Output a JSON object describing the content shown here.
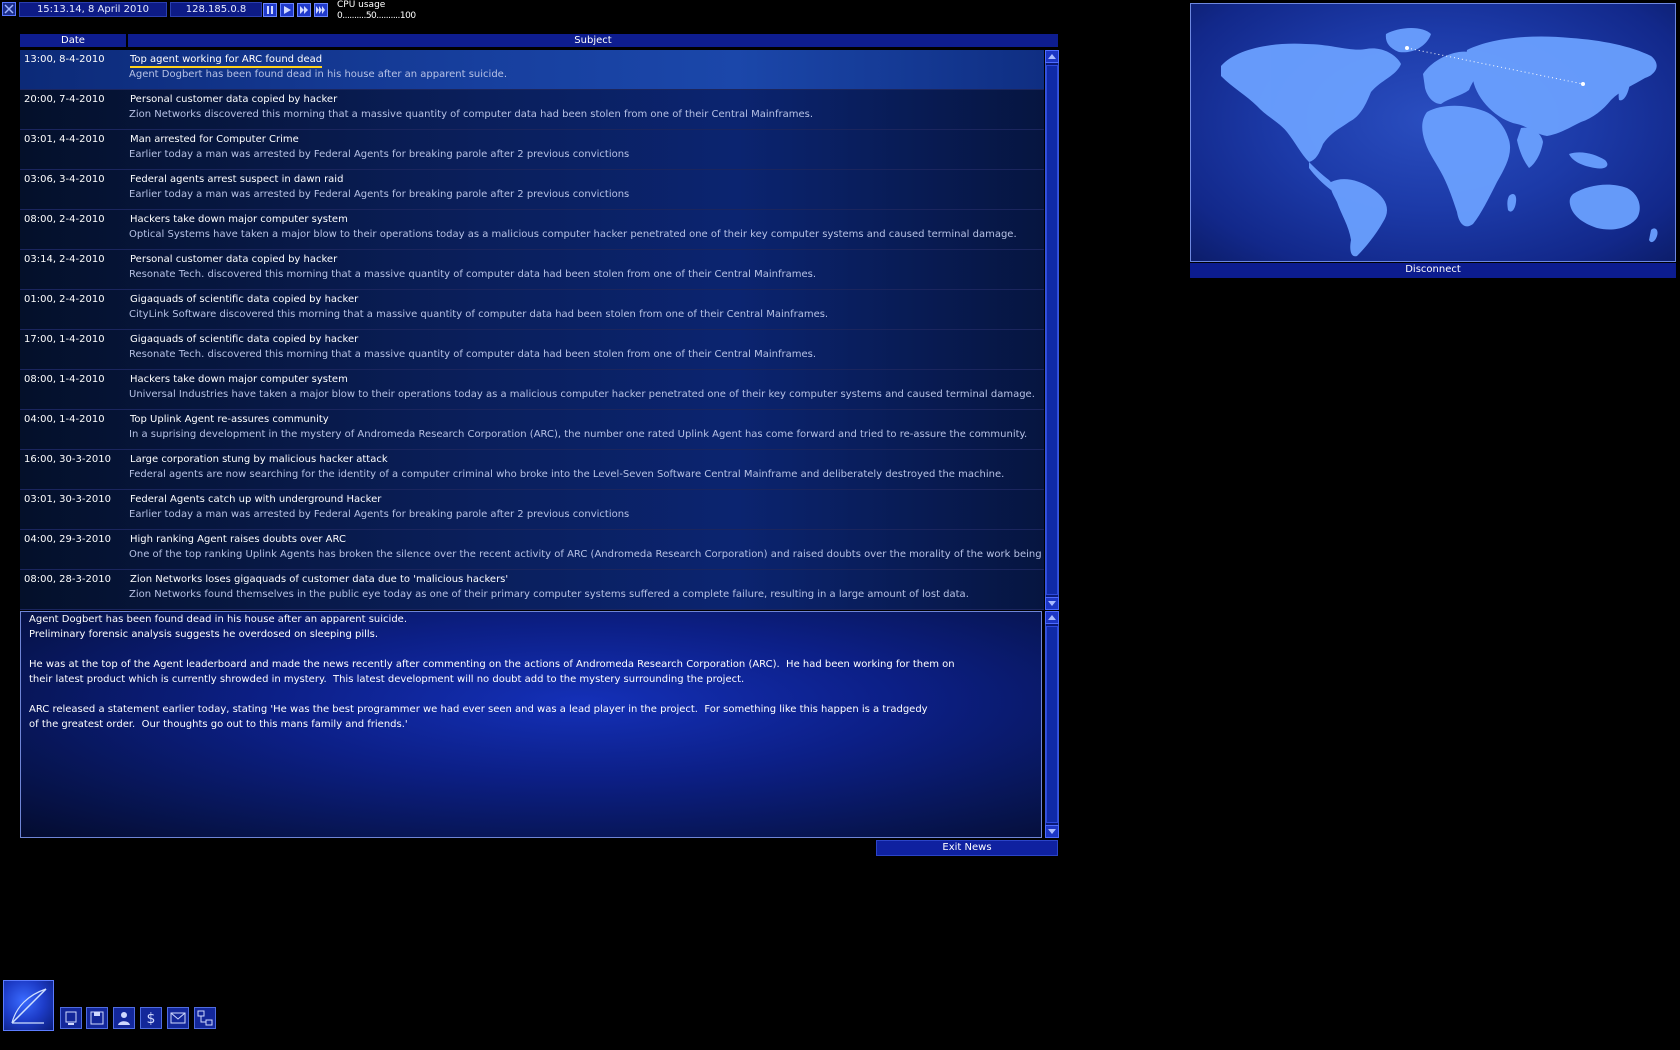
{
  "topbar": {
    "datetime": "15:13.14, 8 April 2010",
    "ip": "128.185.0.8",
    "cpu_label": "CPU usage",
    "cpu_scale": "0..........50..........100",
    "speed_buttons": [
      "pause-icon",
      "play-icon",
      "fast-forward-icon",
      "fastest-icon"
    ]
  },
  "news": {
    "col_date": "Date",
    "col_subject": "Subject",
    "items": [
      {
        "date": "13:00, 8-4-2010",
        "title": "Top agent working for ARC found dead",
        "summary": "Agent Dogbert has been found dead in his house after an apparent suicide.",
        "selected": true
      },
      {
        "date": "20:00, 7-4-2010",
        "title": "Personal customer data copied by hacker",
        "summary": "Zion Networks discovered this morning that a massive quantity of computer data had been stolen from one of their Central Mainframes."
      },
      {
        "date": "03:01, 4-4-2010",
        "title": "Man arrested for Computer Crime",
        "summary": "Earlier today a man was arrested by Federal Agents for breaking parole after 2 previous convictions"
      },
      {
        "date": "03:06, 3-4-2010",
        "title": "Federal agents arrest suspect in dawn raid",
        "summary": "Earlier today a man was arrested by Federal Agents for breaking parole after 2 previous convictions"
      },
      {
        "date": "08:00, 2-4-2010",
        "title": "Hackers take down major computer system",
        "summary": "Optical Systems have taken a major blow to their operations today as a malicious computer hacker penetrated one of their key computer systems and caused terminal damage."
      },
      {
        "date": "03:14, 2-4-2010",
        "title": "Personal customer data copied by hacker",
        "summary": "Resonate Tech. discovered this morning that a massive quantity of computer data had been stolen from one of their Central Mainframes."
      },
      {
        "date": "01:00, 2-4-2010",
        "title": "Gigaquads of scientific data copied by hacker",
        "summary": "CityLink Software discovered this morning that a massive quantity of computer data had been stolen from one of their Central Mainframes."
      },
      {
        "date": "17:00, 1-4-2010",
        "title": "Gigaquads of scientific data copied by hacker",
        "summary": "Resonate Tech. discovered this morning that a massive quantity of computer data had been stolen from one of their Central Mainframes."
      },
      {
        "date": "08:00, 1-4-2010",
        "title": "Hackers take down major computer system",
        "summary": "Universal Industries have taken a major blow to their operations today as a malicious computer hacker penetrated one of their key computer systems and caused terminal damage."
      },
      {
        "date": "04:00, 1-4-2010",
        "title": "Top Uplink Agent re-assures community",
        "summary": "In a suprising development in the mystery of Andromeda Research Corporation (ARC), the number one rated Uplink Agent has come forward and tried to re-assure the community."
      },
      {
        "date": "16:00, 30-3-2010",
        "title": "Large corporation stung by malicious hacker attack",
        "summary": "Federal agents are now searching for the identity of a computer criminal who broke into the Level-Seven Software Central Mainframe and deliberately destroyed the machine."
      },
      {
        "date": "03:01, 30-3-2010",
        "title": "Federal Agents catch up with underground Hacker",
        "summary": "Earlier today a man was arrested by Federal Agents for breaking parole after 2 previous convictions"
      },
      {
        "date": "04:00, 29-3-2010",
        "title": "High ranking Agent raises doubts over ARC",
        "summary": "One of the top ranking Uplink Agents has broken the silence over the recent activity of ARC (Andromeda Research Corporation) and raised doubts over the morality of the work being don"
      },
      {
        "date": "08:00, 28-3-2010",
        "title": "Zion Networks loses gigaquads of customer data due to 'malicious hackers'",
        "summary": "Zion Networks found themselves in the public eye today as one of their primary computer systems suffered a complete failure, resulting in a large amount of lost data."
      }
    ],
    "detail_lines": [
      "Agent Dogbert has been found dead in his house after an apparent suicide.",
      "Preliminary forensic analysis suggests he overdosed on sleeping pills.",
      "He was at the top of the Agent leaderboard and made the news recently after commenting on the actions of Andromeda Research Corporation (ARC).  He had been working for them on",
      "their latest product which is currently shrowded in mystery.  This latest development will no doubt add to the mystery surrounding the project.",
      "ARC released a statement earlier today, stating 'He was the best programmer we had ever seen and was a lead player in the project.  For something like this happen is a tradgedy",
      "of the greatest order.  Our thoughts go out to this mans family and friends.'"
    ],
    "exit_label": "Exit News"
  },
  "map": {
    "disconnect_label": "Disconnect"
  },
  "tray": {
    "icons": [
      "computer-icon",
      "disk-icon",
      "agent-icon",
      "finance-icon",
      "mail-icon",
      "network-icon"
    ]
  },
  "colors": {
    "panel_blue": "#0e1d8f",
    "selection_underline": "#ffd21a",
    "land": "#6aa0ff"
  }
}
